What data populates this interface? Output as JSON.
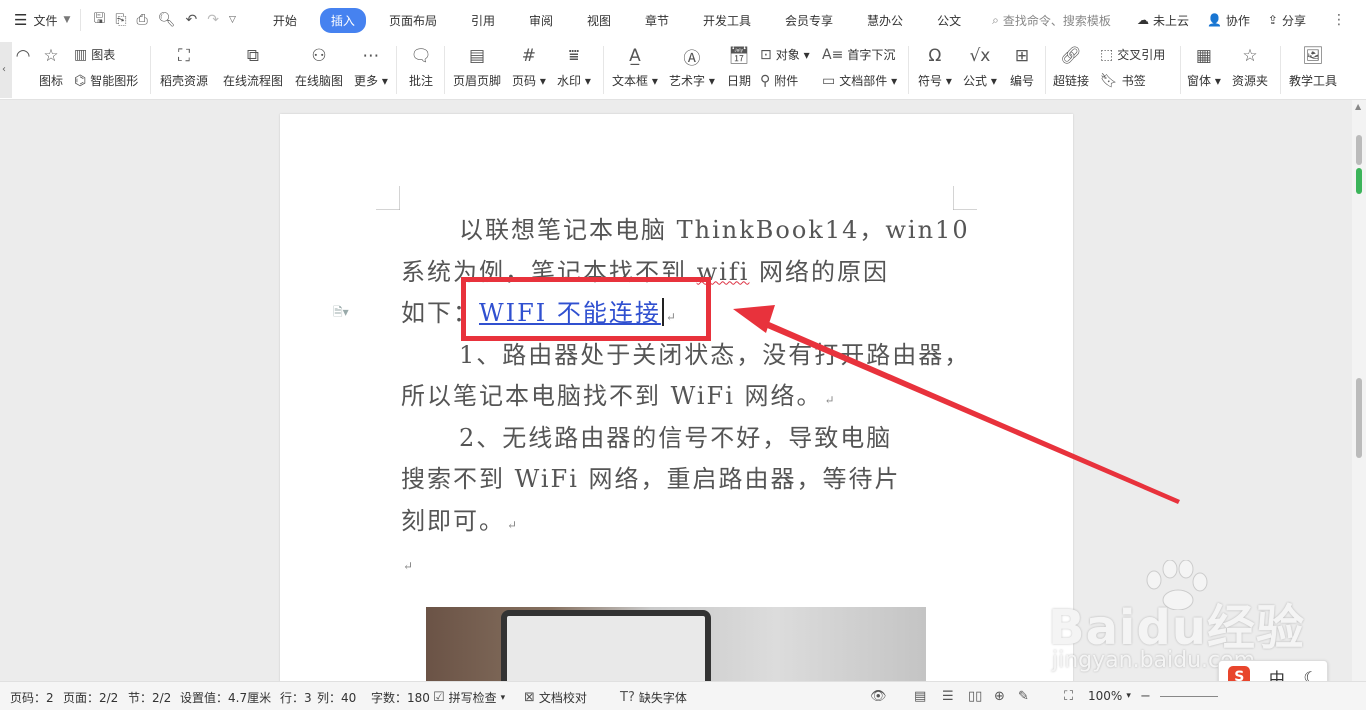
{
  "menubar": {
    "file_label": "文件",
    "tabs": [
      {
        "label": "开始",
        "active": false
      },
      {
        "label": "插入",
        "active": true
      },
      {
        "label": "页面布局",
        "active": false
      },
      {
        "label": "引用",
        "active": false
      },
      {
        "label": "审阅",
        "active": false
      },
      {
        "label": "视图",
        "active": false
      },
      {
        "label": "章节",
        "active": false
      },
      {
        "label": "开发工具",
        "active": false
      },
      {
        "label": "会员专享",
        "active": false
      },
      {
        "label": "慧办公",
        "active": false
      },
      {
        "label": "公文",
        "active": false
      }
    ],
    "search_placeholder": "查找命令、搜索模板",
    "cloud_label": "未上云",
    "collab_label": "协作",
    "share_label": "分享"
  },
  "ribbon": {
    "chart_label": "图表",
    "icon_label": "图标",
    "smartart_label": "智能图形",
    "resources_label": "稻壳资源",
    "flowchart_label": "在线流程图",
    "mindmap_label": "在线脑图",
    "more_label": "更多",
    "comment_label": "批注",
    "header_footer_label": "页眉页脚",
    "page_number_label": "页码",
    "watermark_label": "水印",
    "textbox_label": "文本框",
    "wordart_label": "艺术字",
    "date_label": "日期",
    "object_label": "对象",
    "attachment_label": "附件",
    "dropcap_label": "首字下沉",
    "docpart_label": "文档部件",
    "symbol_label": "符号",
    "formula_label": "公式",
    "numbering_label": "编号",
    "hyperlink_label": "超链接",
    "crossref_label": "交叉引用",
    "bookmark_label": "书签",
    "window_label": "窗体",
    "resource_folder_label": "资源夹",
    "teaching_label": "教学工具"
  },
  "document": {
    "line1": "以联想笔记本电脑 ThinkBook14，win10",
    "line2_a": "系统为例，笔记本找不到 ",
    "line2_wifi": "wifi",
    "line2_b": " 网络的原因",
    "line3_a": "如下：",
    "line3_link": "WIFI 不能连接",
    "line4": "1、路由器处于关闭状态，没有打开路由器，",
    "line5": "所以笔记本电脑找不到 WiFi 网络。",
    "line6": "2、无线路由器的信号不好，导致电脑",
    "line7": "搜索不到 WiFi 网络，重启路由器，等待片",
    "line8": "刻即可。",
    "para_mark": "↵"
  },
  "statusbar": {
    "page_no": "页码：2",
    "pages": "页面：2/2",
    "section": "节：2/2",
    "position": "设置值：4.7厘米",
    "row": "行：3",
    "col": "列：40",
    "words": "字数：180",
    "spellcheck": "拼写检查",
    "proofread": "文档校对",
    "missing_font": "缺失字体",
    "zoom": "100%"
  },
  "watermark": {
    "brand": "Bai",
    "brand2": "du",
    "product": "经验",
    "url": "jingyan.baidu.com"
  },
  "ime": {
    "logo": "S",
    "lang": "中"
  },
  "colors": {
    "accent": "#4682f0",
    "highlight": "#e8323c",
    "link": "#3050d0"
  }
}
